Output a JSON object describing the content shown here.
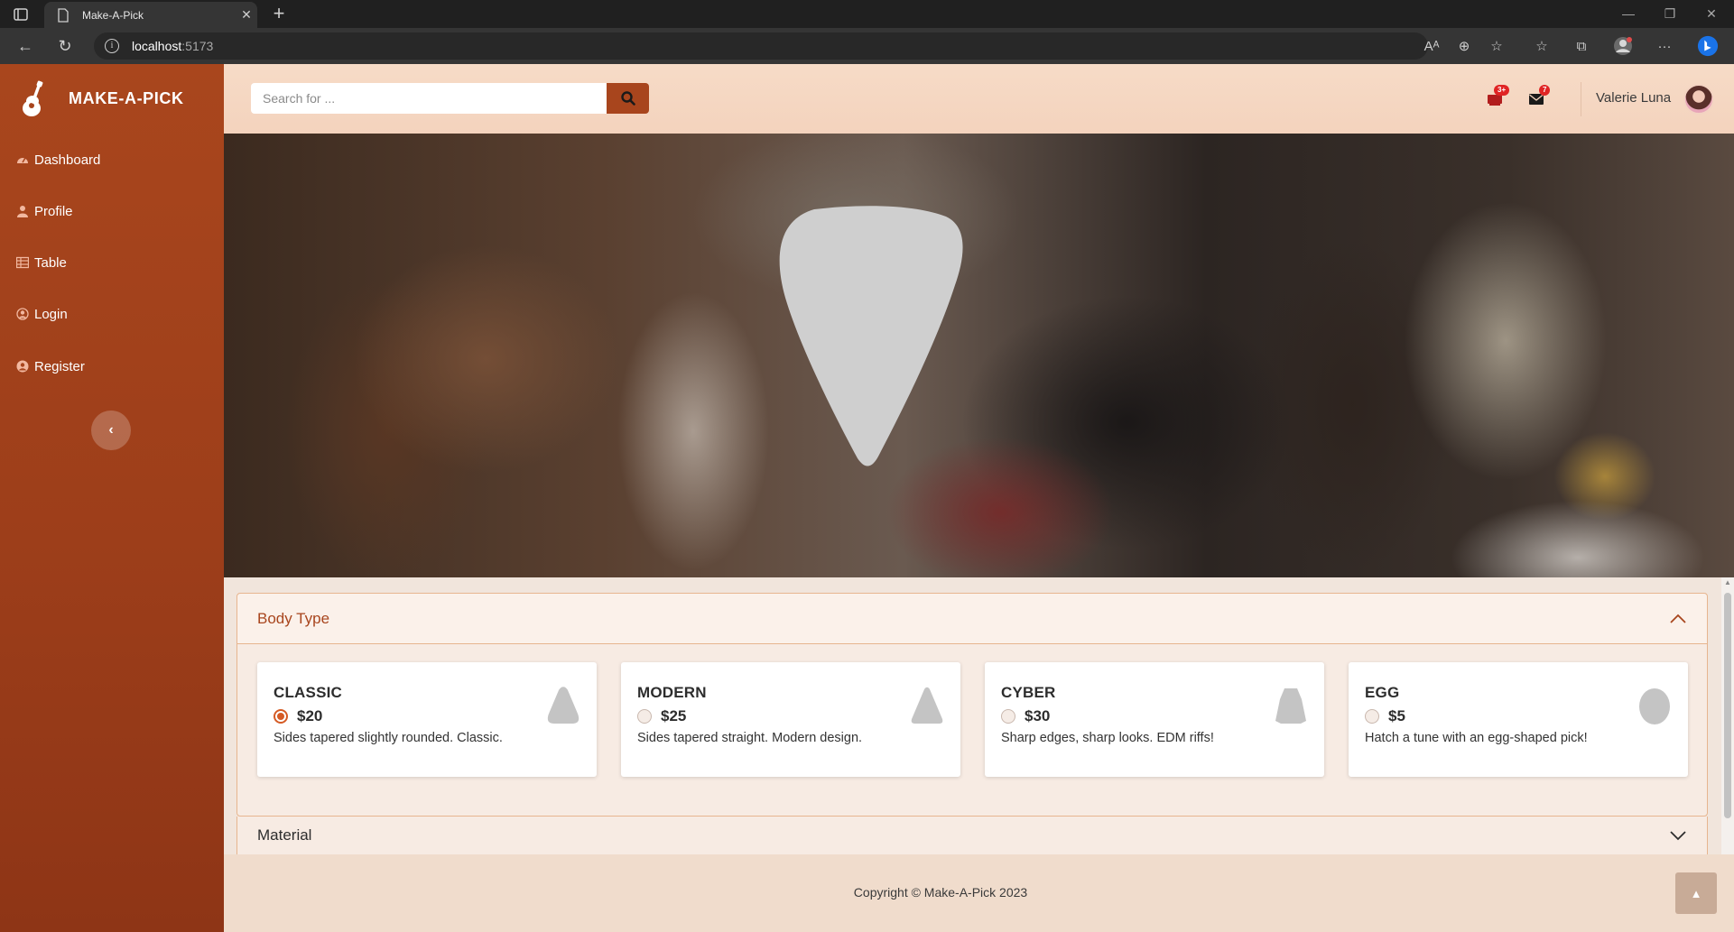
{
  "browser": {
    "tab_title": "Make-A-Pick",
    "url_host": "localhost",
    "url_port": ":5173"
  },
  "sidebar": {
    "brand": "MAKE-A-PICK",
    "items": [
      {
        "label": "Dashboard",
        "icon": "gauge-icon"
      },
      {
        "label": "Profile",
        "icon": "user-icon"
      },
      {
        "label": "Table",
        "icon": "table-icon"
      },
      {
        "label": "Login",
        "icon": "user-circle-icon"
      },
      {
        "label": "Register",
        "icon": "user-circle-icon"
      }
    ]
  },
  "header": {
    "search_placeholder": "Search for ...",
    "alerts_count": "3+",
    "messages_count": "7",
    "user_name": "Valerie Luna"
  },
  "body_type": {
    "title": "Body Type",
    "options": [
      {
        "name": "CLASSIC",
        "price": "$20",
        "description": "Sides tapered slightly rounded. Classic.",
        "selected": true
      },
      {
        "name": "MODERN",
        "price": "$25",
        "description": "Sides tapered straight. Modern design.",
        "selected": false
      },
      {
        "name": "CYBER",
        "price": "$30",
        "description": "Sharp edges, sharp looks. EDM riffs!",
        "selected": false
      },
      {
        "name": "EGG",
        "price": "$5",
        "description": "Hatch a tune with an egg-shaped pick!",
        "selected": false
      }
    ]
  },
  "material": {
    "title": "Material"
  },
  "footer": {
    "copyright": "Copyright © Make-A-Pick 2023"
  },
  "colors": {
    "brand": "#a8451d",
    "accent": "#d55b25",
    "header_bg": "#f6dbc7"
  }
}
